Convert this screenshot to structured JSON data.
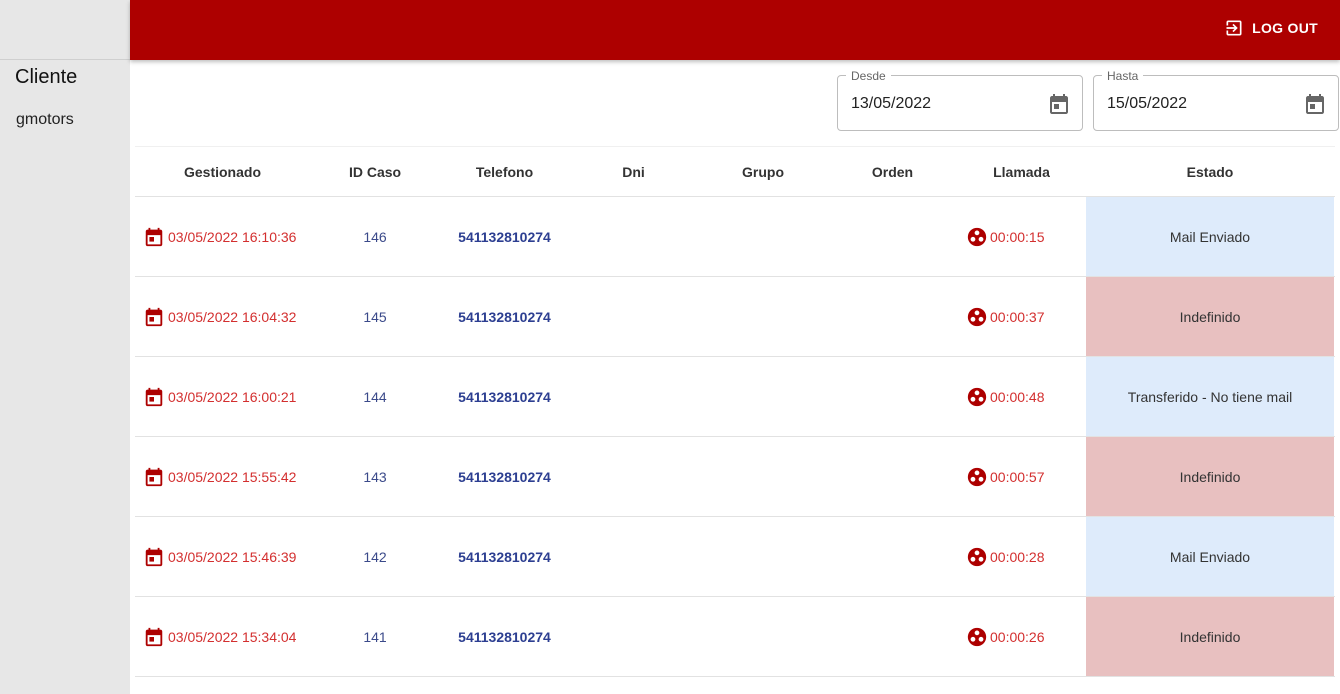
{
  "colors": {
    "brand": "#ad0000",
    "date_red": "#d32f2f",
    "phone_blue": "#2c3e91",
    "status_blue": "#deebfb",
    "status_red": "#e8c0c0"
  },
  "sidebar": {
    "title": "Cliente",
    "client": "gmotors"
  },
  "topbar": {
    "logout_label": "LOG OUT",
    "logout_icon": "logout-icon"
  },
  "filters": {
    "desde": {
      "label": "Desde",
      "value": "13/05/2022",
      "icon": "calendar-icon"
    },
    "hasta": {
      "label": "Hasta",
      "value": "15/05/2022",
      "icon": "calendar-icon"
    }
  },
  "table": {
    "headers": {
      "gestionado": "Gestionado",
      "id_caso": "ID Caso",
      "telefono": "Telefono",
      "dni": "Dni",
      "grupo": "Grupo",
      "orden": "Orden",
      "llamada": "Llamada",
      "estado": "Estado"
    },
    "rows": [
      {
        "gestionado": "03/05/2022 16:10:36",
        "id": "146",
        "telefono": "541132810274",
        "dni": "",
        "grupo": "",
        "orden": "",
        "llamada": "00:00:15",
        "estado": "Mail Enviado"
      },
      {
        "gestionado": "03/05/2022 16:04:32",
        "id": "145",
        "telefono": "541132810274",
        "dni": "",
        "grupo": "",
        "orden": "",
        "llamada": "00:00:37",
        "estado": "Indefinido"
      },
      {
        "gestionado": "03/05/2022 16:00:21",
        "id": "144",
        "telefono": "541132810274",
        "dni": "",
        "grupo": "",
        "orden": "",
        "llamada": "00:00:48",
        "estado": "Transferido - No tiene mail"
      },
      {
        "gestionado": "03/05/2022 15:55:42",
        "id": "143",
        "telefono": "541132810274",
        "dni": "",
        "grupo": "",
        "orden": "",
        "llamada": "00:00:57",
        "estado": "Indefinido"
      },
      {
        "gestionado": "03/05/2022 15:46:39",
        "id": "142",
        "telefono": "541132810274",
        "dni": "",
        "grupo": "",
        "orden": "",
        "llamada": "00:00:28",
        "estado": "Mail Enviado"
      },
      {
        "gestionado": "03/05/2022 15:34:04",
        "id": "141",
        "telefono": "541132810274",
        "dni": "",
        "grupo": "",
        "orden": "",
        "llamada": "00:00:26",
        "estado": "Indefinido"
      }
    ]
  }
}
